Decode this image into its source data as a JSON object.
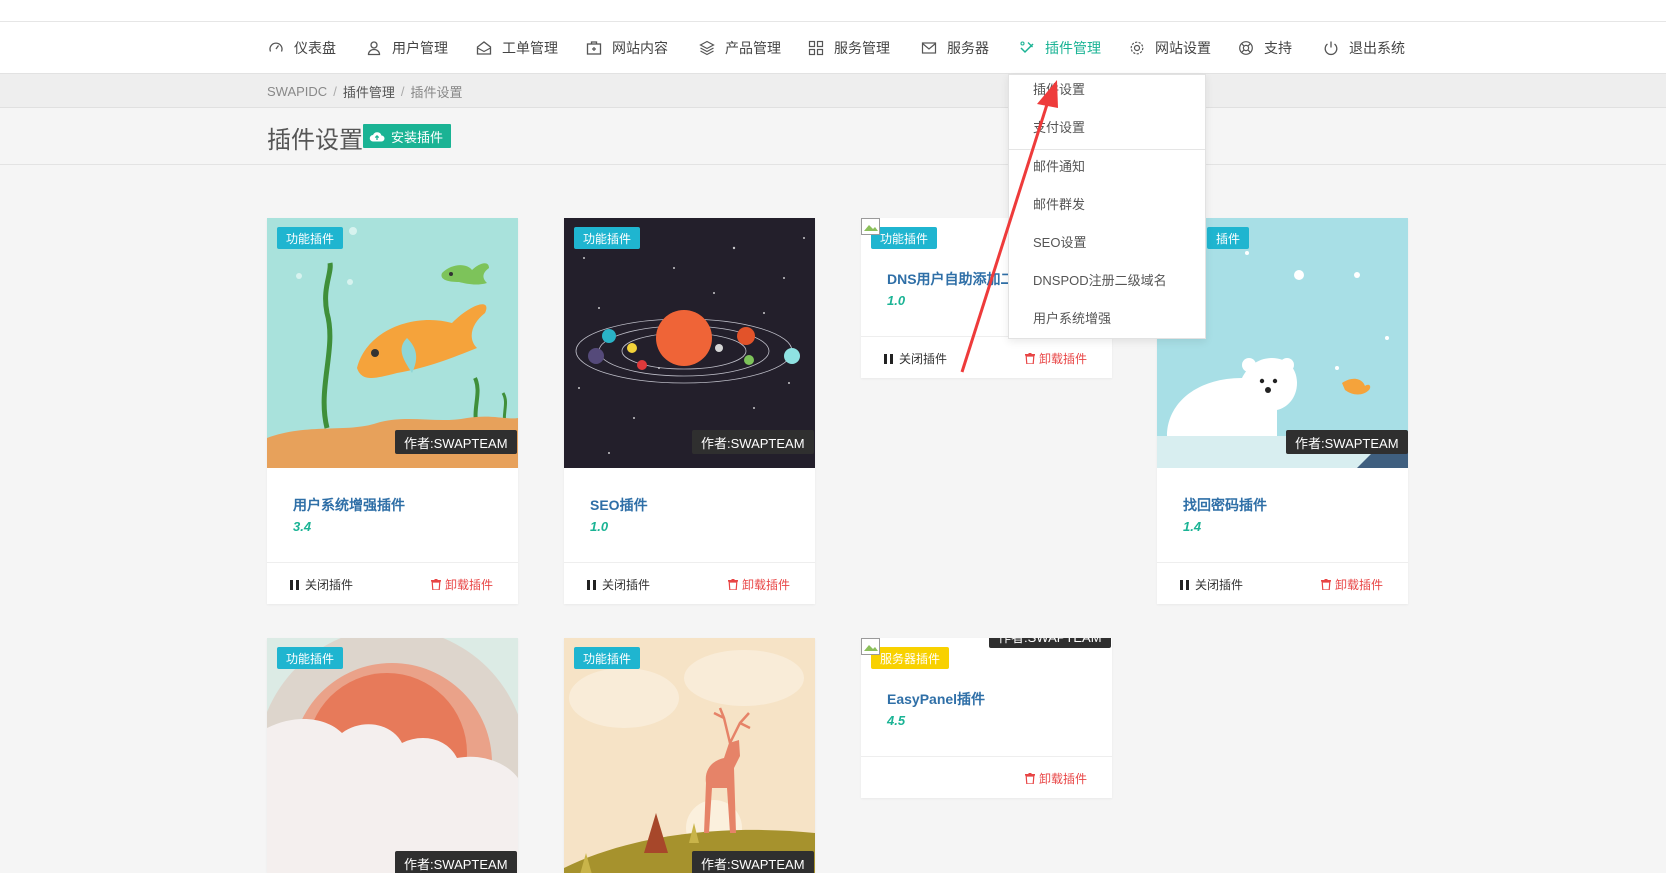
{
  "nav": {
    "items": [
      {
        "label": "仪表盘",
        "icon": "dashboard-icon"
      },
      {
        "label": "用户管理",
        "icon": "user-icon"
      },
      {
        "label": "工单管理",
        "icon": "ticket-icon"
      },
      {
        "label": "网站内容",
        "icon": "content-icon"
      },
      {
        "label": "产品管理",
        "icon": "layers-icon"
      },
      {
        "label": "服务管理",
        "icon": "grid-icon"
      },
      {
        "label": "服务器",
        "icon": "envelope-icon"
      },
      {
        "label": "插件管理",
        "icon": "plugin-icon",
        "active": true
      },
      {
        "label": "网站设置",
        "icon": "gear-icon"
      },
      {
        "label": "支持",
        "icon": "lifebuoy-icon"
      },
      {
        "label": "退出系统",
        "icon": "power-icon"
      }
    ],
    "active_color": "#1ab394"
  },
  "breadcrumb": {
    "root": "SWAPIDC",
    "middle": "插件管理",
    "current": "插件设置",
    "separator": "/"
  },
  "page": {
    "title": "插件设置",
    "install_button": "安装插件"
  },
  "dropdown": {
    "items": [
      "插件设置",
      "支付设置",
      "邮件通知",
      "邮件群发",
      "SEO设置",
      "DNSPOD注册二级域名",
      "用户系统增强"
    ]
  },
  "cards": [
    {
      "tag": "功能插件",
      "author": "作者:SWAPTEAM",
      "name": "用户系统增强插件",
      "version": "3.4",
      "close": "关闭插件",
      "uninstall": "卸载插件",
      "image": "fish-illustration"
    },
    {
      "tag": "功能插件",
      "author": "作者:SWAPTEAM",
      "name": "SEO插件",
      "version": "1.0",
      "close": "关闭插件",
      "uninstall": "卸载插件",
      "image": "solar-system-illustration"
    },
    {
      "tag": "功能插件",
      "name": "DNS用户自助添加二",
      "version": "1.0",
      "close": "关闭插件",
      "uninstall": "卸载插件",
      "image": "broken-image"
    },
    {
      "tag": "插件",
      "author": "作者:SWAPTEAM",
      "name": "找回密码插件",
      "version": "1.4",
      "close": "关闭插件",
      "uninstall": "卸载插件",
      "image": "polar-bear-illustration"
    },
    {
      "tag": "功能插件",
      "author": "作者:SWAPTEAM",
      "image": "sun-cloud-illustration"
    },
    {
      "tag": "功能插件",
      "author": "作者:SWAPTEAM",
      "image": "deer-illustration"
    },
    {
      "tag": "服务器插件",
      "author": "作者:SWAPTEAM",
      "name": "EasyPanel插件",
      "version": "4.5",
      "uninstall": "卸载插件",
      "image": "broken-image"
    }
  ],
  "colors": {
    "accent": "#1ab394",
    "tag_blue": "#1fb5d0",
    "tag_yellow": "#f8d100",
    "danger": "#e84545",
    "link": "#2f6fa7",
    "annotation_arrow": "#ee3b3b"
  }
}
